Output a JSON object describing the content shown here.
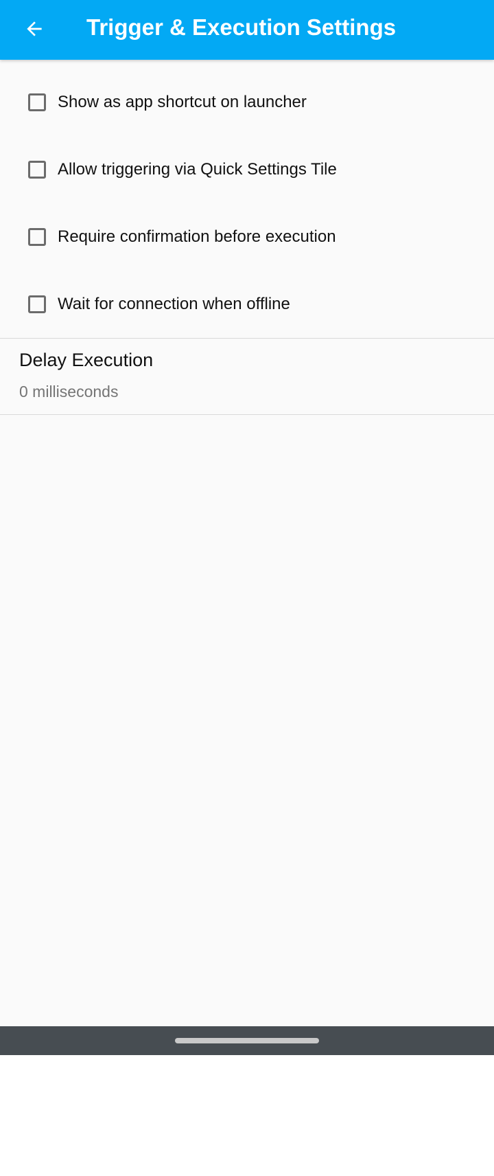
{
  "appbar": {
    "title": "Trigger & Execution Settings",
    "back_icon": "arrow-back-icon",
    "background_color": "#03a9f4"
  },
  "options": [
    {
      "label": "Show as app shortcut on launcher",
      "checked": false
    },
    {
      "label": "Allow triggering via Quick Settings Tile",
      "checked": false
    },
    {
      "label": "Require confirmation before execution",
      "checked": false
    },
    {
      "label": "Wait for connection when offline",
      "checked": false
    }
  ],
  "delay": {
    "title": "Delay Execution",
    "summary": "0 milliseconds"
  },
  "navbar": {
    "home_handle": "home-handle"
  }
}
